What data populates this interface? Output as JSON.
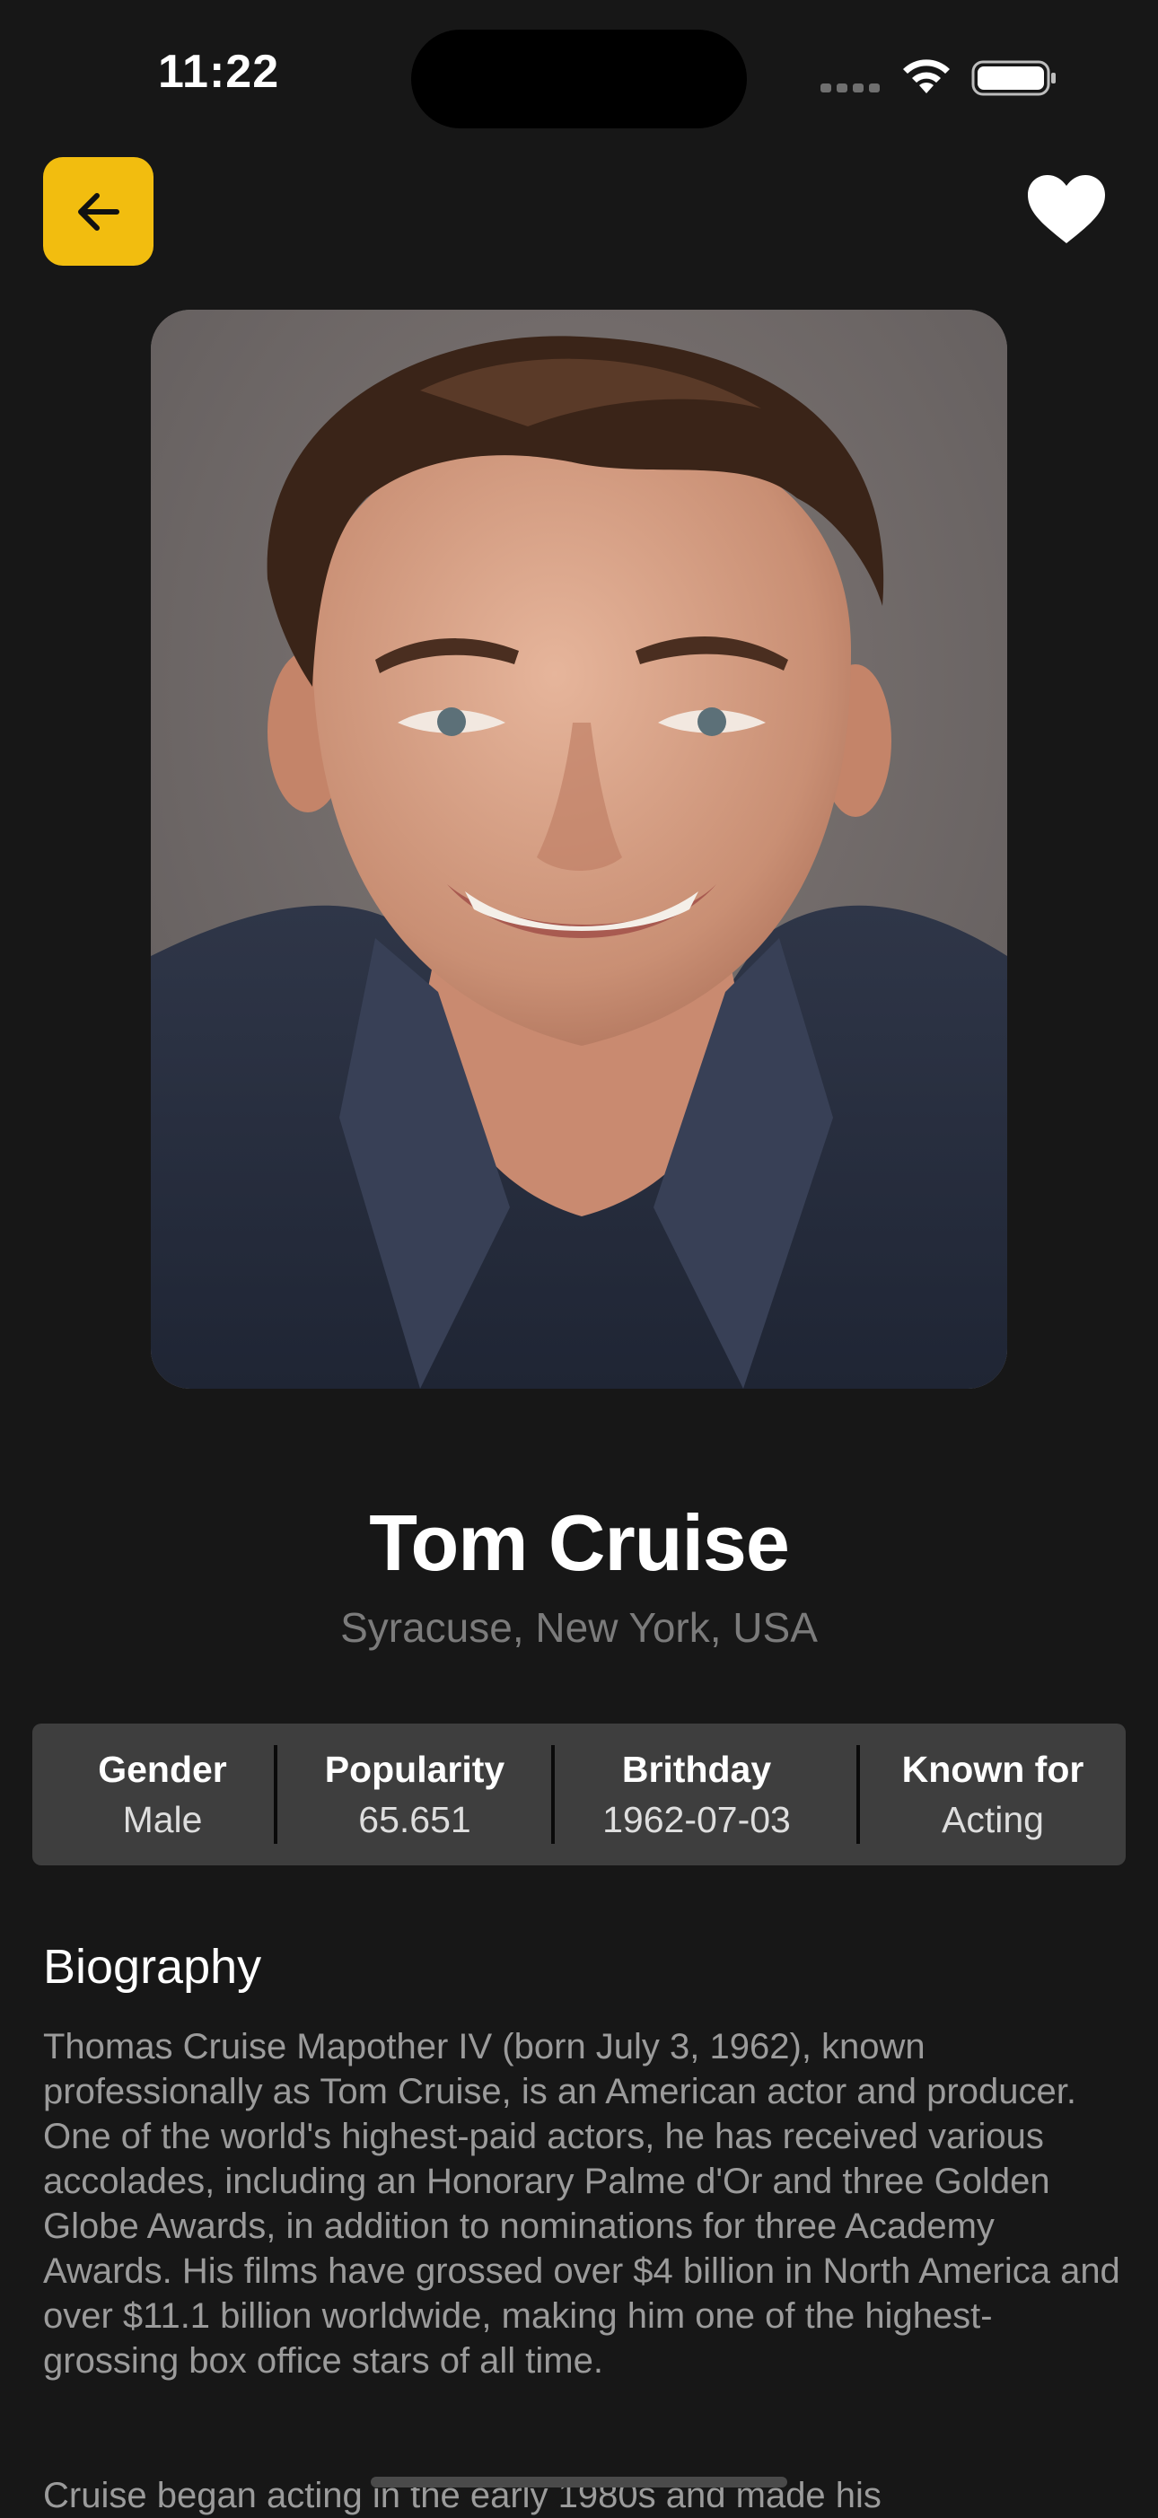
{
  "status_bar": {
    "time": "11:22"
  },
  "nav": {
    "back_icon": "arrow-left-icon",
    "favorite_icon": "heart-icon",
    "accent_color": "#f2bd0f"
  },
  "person": {
    "name": "Tom Cruise",
    "birthplace": "Syracuse, New York, USA"
  },
  "stats": [
    {
      "label": "Gender",
      "value": "Male"
    },
    {
      "label": "Popularity",
      "value": "65.651"
    },
    {
      "label": "Brithday",
      "value": "1962-07-03"
    },
    {
      "label": "Known for",
      "value": "Acting"
    }
  ],
  "biography": {
    "heading": "Biography",
    "paragraph_1": "Thomas Cruise Mapother IV (born July 3, 1962), known professionally as Tom Cruise, is an American actor and producer. One of the world's highest-paid actors, he has received various accolades, including an Honorary Palme d'Or and three Golden Globe Awards, in addition to nominations for three Academy Awards. His films have grossed over $4 billion in North America and over $11.1 billion worldwide, making him one of the highest-grossing box office stars of all time.",
    "paragraph_2": "Cruise began acting in the early 1980s and made his"
  }
}
